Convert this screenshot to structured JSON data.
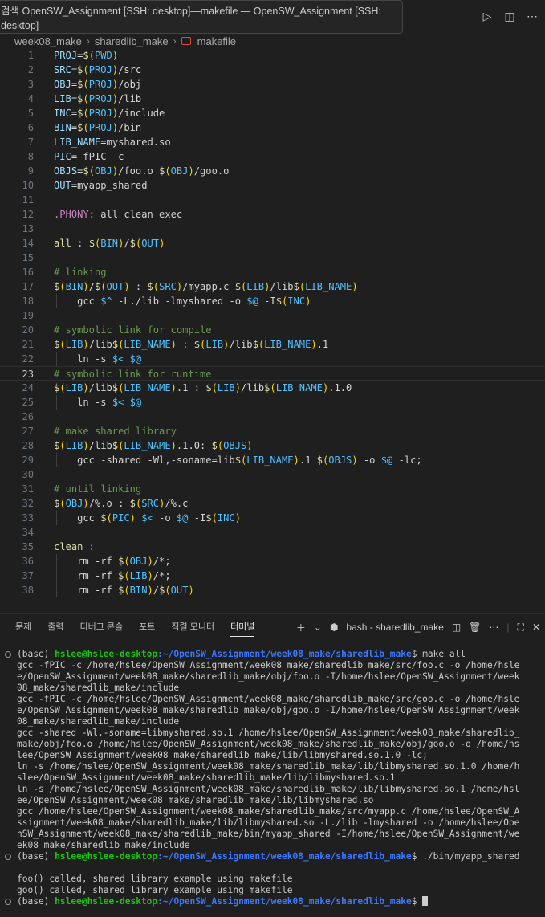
{
  "window": {
    "tooltip_line1": "검색 OpenSW_Assignment [SSH: desktop]—makefile — OpenSW_Assignment [SSH:",
    "tooltip_line2": "desktop]"
  },
  "breadcrumb": [
    "week08_make",
    "sharedlib_make",
    "makefile"
  ],
  "editor": {
    "active_line": 23,
    "lines": [
      {
        "n": "1",
        "parts": [
          [
            "var",
            "PROJ"
          ],
          [
            "op",
            "="
          ],
          [
            "dollar",
            "$"
          ],
          [
            "paren",
            "("
          ],
          [
            "mk",
            "PWD"
          ],
          [
            "paren",
            ")"
          ]
        ]
      },
      {
        "n": "2",
        "parts": [
          [
            "var",
            "SRC"
          ],
          [
            "op",
            "="
          ],
          [
            "dollar",
            "$"
          ],
          [
            "paren",
            "("
          ],
          [
            "mk",
            "PROJ"
          ],
          [
            "paren",
            ")"
          ],
          [
            "op",
            "/src"
          ]
        ]
      },
      {
        "n": "3",
        "parts": [
          [
            "var",
            "OBJ"
          ],
          [
            "op",
            "="
          ],
          [
            "dollar",
            "$"
          ],
          [
            "paren",
            "("
          ],
          [
            "mk",
            "PROJ"
          ],
          [
            "paren",
            ")"
          ],
          [
            "op",
            "/obj"
          ]
        ]
      },
      {
        "n": "4",
        "parts": [
          [
            "var",
            "LIB"
          ],
          [
            "op",
            "="
          ],
          [
            "dollar",
            "$"
          ],
          [
            "paren",
            "("
          ],
          [
            "mk",
            "PROJ"
          ],
          [
            "paren",
            ")"
          ],
          [
            "op",
            "/lib"
          ]
        ]
      },
      {
        "n": "5",
        "parts": [
          [
            "var",
            "INC"
          ],
          [
            "op",
            "="
          ],
          [
            "dollar",
            "$"
          ],
          [
            "paren",
            "("
          ],
          [
            "mk",
            "PROJ"
          ],
          [
            "paren",
            ")"
          ],
          [
            "op",
            "/include"
          ]
        ]
      },
      {
        "n": "6",
        "parts": [
          [
            "var",
            "BIN"
          ],
          [
            "op",
            "="
          ],
          [
            "dollar",
            "$"
          ],
          [
            "paren",
            "("
          ],
          [
            "mk",
            "PROJ"
          ],
          [
            "paren",
            ")"
          ],
          [
            "op",
            "/bin"
          ]
        ]
      },
      {
        "n": "7",
        "parts": [
          [
            "var",
            "LIB_NAME"
          ],
          [
            "op",
            "=myshared.so"
          ]
        ]
      },
      {
        "n": "8",
        "parts": [
          [
            "var",
            "PIC"
          ],
          [
            "op",
            "=-fPIC -c"
          ]
        ]
      },
      {
        "n": "9",
        "parts": [
          [
            "var",
            "OBJS"
          ],
          [
            "op",
            "="
          ],
          [
            "dollar",
            "$"
          ],
          [
            "paren",
            "("
          ],
          [
            "mk",
            "OBJ"
          ],
          [
            "paren",
            ")"
          ],
          [
            "op",
            "/foo.o "
          ],
          [
            "dollar",
            "$"
          ],
          [
            "paren",
            "("
          ],
          [
            "mk",
            "OBJ"
          ],
          [
            "paren",
            ")"
          ],
          [
            "op",
            "/goo.o"
          ]
        ]
      },
      {
        "n": "10",
        "parts": [
          [
            "var",
            "OUT"
          ],
          [
            "op",
            "=myapp_shared"
          ]
        ]
      },
      {
        "n": "11",
        "parts": []
      },
      {
        "n": "12",
        "parts": [
          [
            "kw",
            ".PHONY"
          ],
          [
            "op",
            ": all clean exec"
          ]
        ]
      },
      {
        "n": "13",
        "parts": []
      },
      {
        "n": "14",
        "parts": [
          [
            "target",
            "all"
          ],
          [
            "op",
            " : "
          ],
          [
            "dollar",
            "$"
          ],
          [
            "paren",
            "("
          ],
          [
            "mk",
            "BIN"
          ],
          [
            "paren",
            ")"
          ],
          [
            "op",
            "/"
          ],
          [
            "dollar",
            "$"
          ],
          [
            "paren",
            "("
          ],
          [
            "mk",
            "OUT"
          ],
          [
            "paren",
            ")"
          ]
        ]
      },
      {
        "n": "15",
        "parts": []
      },
      {
        "n": "16",
        "parts": [
          [
            "comment",
            "# linking"
          ]
        ]
      },
      {
        "n": "17",
        "parts": [
          [
            "dollar",
            "$"
          ],
          [
            "paren",
            "("
          ],
          [
            "mk",
            "BIN"
          ],
          [
            "paren",
            ")"
          ],
          [
            "op",
            "/"
          ],
          [
            "dollar",
            "$"
          ],
          [
            "paren",
            "("
          ],
          [
            "mk",
            "OUT"
          ],
          [
            "paren",
            ")"
          ],
          [
            "op",
            " : "
          ],
          [
            "dollar",
            "$"
          ],
          [
            "paren",
            "("
          ],
          [
            "mk",
            "SRC"
          ],
          [
            "paren",
            ")"
          ],
          [
            "op",
            "/myapp.c "
          ],
          [
            "dollar",
            "$"
          ],
          [
            "paren",
            "("
          ],
          [
            "mk",
            "LIB"
          ],
          [
            "paren",
            ")"
          ],
          [
            "op",
            "/lib"
          ],
          [
            "dollar",
            "$"
          ],
          [
            "paren",
            "("
          ],
          [
            "mk",
            "LIB_NAME"
          ],
          [
            "paren",
            ")"
          ]
        ]
      },
      {
        "n": "18",
        "parts": [
          [
            "op",
            "    gcc "
          ],
          [
            "mk",
            "$^"
          ],
          [
            "op",
            " -L./lib -lmyshared -o "
          ],
          [
            "mk",
            "$@"
          ],
          [
            "op",
            " -I"
          ],
          [
            "dollar",
            "$"
          ],
          [
            "paren",
            "("
          ],
          [
            "mk",
            "INC"
          ],
          [
            "paren",
            ")"
          ]
        ]
      },
      {
        "n": "19",
        "parts": []
      },
      {
        "n": "20",
        "parts": [
          [
            "comment",
            "# symbolic link for compile"
          ]
        ]
      },
      {
        "n": "21",
        "parts": [
          [
            "dollar",
            "$"
          ],
          [
            "paren",
            "("
          ],
          [
            "mk",
            "LIB"
          ],
          [
            "paren",
            ")"
          ],
          [
            "op",
            "/lib"
          ],
          [
            "dollar",
            "$"
          ],
          [
            "paren",
            "("
          ],
          [
            "mk",
            "LIB_NAME"
          ],
          [
            "paren",
            ")"
          ],
          [
            "op",
            " : "
          ],
          [
            "dollar",
            "$"
          ],
          [
            "paren",
            "("
          ],
          [
            "mk",
            "LIB"
          ],
          [
            "paren",
            ")"
          ],
          [
            "op",
            "/lib"
          ],
          [
            "dollar",
            "$"
          ],
          [
            "paren",
            "("
          ],
          [
            "mk",
            "LIB_NAME"
          ],
          [
            "paren",
            ")"
          ],
          [
            "op",
            ".1"
          ]
        ]
      },
      {
        "n": "22",
        "parts": [
          [
            "op",
            "    ln -s "
          ],
          [
            "mk",
            "$<"
          ],
          [
            "op",
            " "
          ],
          [
            "mk",
            "$@"
          ]
        ]
      },
      {
        "n": "23",
        "parts": [
          [
            "comment",
            "# symbolic link for runtime"
          ]
        ]
      },
      {
        "n": "24",
        "parts": [
          [
            "dollar",
            "$"
          ],
          [
            "paren",
            "("
          ],
          [
            "mk",
            "LIB"
          ],
          [
            "paren",
            ")"
          ],
          [
            "op",
            "/lib"
          ],
          [
            "dollar",
            "$"
          ],
          [
            "paren",
            "("
          ],
          [
            "mk",
            "LIB_NAME"
          ],
          [
            "paren",
            ")"
          ],
          [
            "op",
            ".1 : "
          ],
          [
            "dollar",
            "$"
          ],
          [
            "paren",
            "("
          ],
          [
            "mk",
            "LIB"
          ],
          [
            "paren",
            ")"
          ],
          [
            "op",
            "/lib"
          ],
          [
            "dollar",
            "$"
          ],
          [
            "paren",
            "("
          ],
          [
            "mk",
            "LIB_NAME"
          ],
          [
            "paren",
            ")"
          ],
          [
            "op",
            ".1.0"
          ]
        ]
      },
      {
        "n": "25",
        "parts": [
          [
            "op",
            "    ln -s "
          ],
          [
            "mk",
            "$<"
          ],
          [
            "op",
            " "
          ],
          [
            "mk",
            "$@"
          ]
        ]
      },
      {
        "n": "26",
        "parts": []
      },
      {
        "n": "27",
        "parts": [
          [
            "comment",
            "# make shared library"
          ]
        ]
      },
      {
        "n": "28",
        "parts": [
          [
            "dollar",
            "$"
          ],
          [
            "paren",
            "("
          ],
          [
            "mk",
            "LIB"
          ],
          [
            "paren",
            ")"
          ],
          [
            "op",
            "/lib"
          ],
          [
            "dollar",
            "$"
          ],
          [
            "paren",
            "("
          ],
          [
            "mk",
            "LIB_NAME"
          ],
          [
            "paren",
            ")"
          ],
          [
            "op",
            ".1.0: "
          ],
          [
            "dollar",
            "$"
          ],
          [
            "paren",
            "("
          ],
          [
            "mk",
            "OBJS"
          ],
          [
            "paren",
            ")"
          ]
        ]
      },
      {
        "n": "29",
        "parts": [
          [
            "op",
            "    gcc -shared -Wl,-soname=lib"
          ],
          [
            "dollar",
            "$"
          ],
          [
            "paren",
            "("
          ],
          [
            "mk",
            "LIB_NAME"
          ],
          [
            "paren",
            ")"
          ],
          [
            "op",
            ".1 "
          ],
          [
            "dollar",
            "$"
          ],
          [
            "paren",
            "("
          ],
          [
            "mk",
            "OBJS"
          ],
          [
            "paren",
            ")"
          ],
          [
            "op",
            " -o "
          ],
          [
            "mk",
            "$@"
          ],
          [
            "op",
            " -lc;"
          ]
        ]
      },
      {
        "n": "30",
        "parts": []
      },
      {
        "n": "31",
        "parts": [
          [
            "comment",
            "# until linking"
          ]
        ]
      },
      {
        "n": "32",
        "parts": [
          [
            "dollar",
            "$"
          ],
          [
            "paren",
            "("
          ],
          [
            "mk",
            "OBJ"
          ],
          [
            "paren",
            ")"
          ],
          [
            "op",
            "/%.o : "
          ],
          [
            "dollar",
            "$"
          ],
          [
            "paren",
            "("
          ],
          [
            "mk",
            "SRC"
          ],
          [
            "paren",
            ")"
          ],
          [
            "op",
            "/%.c"
          ]
        ]
      },
      {
        "n": "33",
        "parts": [
          [
            "op",
            "    gcc "
          ],
          [
            "dollar",
            "$"
          ],
          [
            "paren",
            "("
          ],
          [
            "mk",
            "PIC"
          ],
          [
            "paren",
            ")"
          ],
          [
            "op",
            " "
          ],
          [
            "mk",
            "$<"
          ],
          [
            "op",
            " -o "
          ],
          [
            "mk",
            "$@"
          ],
          [
            "op",
            " -I"
          ],
          [
            "dollar",
            "$"
          ],
          [
            "paren",
            "("
          ],
          [
            "mk",
            "INC"
          ],
          [
            "paren",
            ")"
          ]
        ]
      },
      {
        "n": "34",
        "parts": []
      },
      {
        "n": "35",
        "parts": [
          [
            "target",
            "clean"
          ],
          [
            "op",
            " :"
          ]
        ]
      },
      {
        "n": "36",
        "parts": [
          [
            "op",
            "    rm -rf "
          ],
          [
            "dollar",
            "$"
          ],
          [
            "paren",
            "("
          ],
          [
            "mk",
            "OBJ"
          ],
          [
            "paren",
            ")"
          ],
          [
            "op",
            "/*;"
          ]
        ]
      },
      {
        "n": "37",
        "parts": [
          [
            "op",
            "    rm -rf "
          ],
          [
            "dollar",
            "$"
          ],
          [
            "paren",
            "("
          ],
          [
            "mk",
            "LIB"
          ],
          [
            "paren",
            ")"
          ],
          [
            "op",
            "/*;"
          ]
        ]
      },
      {
        "n": "38",
        "parts": [
          [
            "op",
            "    rm -rf "
          ],
          [
            "dollar",
            "$"
          ],
          [
            "paren",
            "("
          ],
          [
            "mk",
            "BIN"
          ],
          [
            "paren",
            ")"
          ],
          [
            "op",
            "/"
          ],
          [
            "dollar",
            "$"
          ],
          [
            "paren",
            "("
          ],
          [
            "mk",
            "OUT"
          ],
          [
            "paren",
            ")"
          ]
        ]
      }
    ]
  },
  "panel": {
    "tabs": [
      "문제",
      "출력",
      "디버그 콘솔",
      "포트",
      "직렬 모니터",
      "터미널"
    ],
    "active_tab": "터미널",
    "terminal_name": "bash - sharedlib_make"
  },
  "terminal": {
    "prompt_prefix": "(base) ",
    "user_host": "hslee@hslee-desktop",
    "cwd": ":~/OpenSW_Assignment/week08_make/sharedlib_make",
    "cmd1": "$ make all",
    "output1": [
      "gcc -fPIC -c /home/hslee/OpenSW_Assignment/week08_make/sharedlib_make/src/foo.c -o /home/hsle",
      "e/OpenSW_Assignment/week08_make/sharedlib_make/obj/foo.o -I/home/hslee/OpenSW_Assignment/week",
      "08_make/sharedlib_make/include",
      "gcc -fPIC -c /home/hslee/OpenSW_Assignment/week08_make/sharedlib_make/src/goo.c -o /home/hsle",
      "e/OpenSW_Assignment/week08_make/sharedlib_make/obj/goo.o -I/home/hslee/OpenSW_Assignment/week",
      "08_make/sharedlib_make/include",
      "gcc -shared -Wl,-soname=libmyshared.so.1 /home/hslee/OpenSW_Assignment/week08_make/sharedlib_",
      "make/obj/foo.o /home/hslee/OpenSW_Assignment/week08_make/sharedlib_make/obj/goo.o -o /home/hs",
      "lee/OpenSW_Assignment/week08_make/sharedlib_make/lib/libmyshared.so.1.0 -lc;",
      "ln -s /home/hslee/OpenSW_Assignment/week08_make/sharedlib_make/lib/libmyshared.so.1.0 /home/h",
      "slee/OpenSW_Assignment/week08_make/sharedlib_make/lib/libmyshared.so.1",
      "ln -s /home/hslee/OpenSW_Assignment/week08_make/sharedlib_make/lib/libmyshared.so.1 /home/hsl",
      "ee/OpenSW_Assignment/week08_make/sharedlib_make/lib/libmyshared.so",
      "gcc /home/hslee/OpenSW_Assignment/week08_make/sharedlib_make/src/myapp.c /home/hslee/OpenSW_A",
      "ssignment/week08_make/sharedlib_make/lib/libmyshared.so -L./lib -lmyshared -o /home/hslee/Ope",
      "nSW_Assignment/week08_make/sharedlib_make/bin/myapp_shared -I/home/hslee/OpenSW_Assignment/we",
      "ek08_make/sharedlib_make/include"
    ],
    "cmd2": "$ ./bin/myapp_shared",
    "output2": [
      "foo() called, shared library example using makefile",
      "goo() called, shared library example using makefile"
    ],
    "cmd3": "$ "
  }
}
